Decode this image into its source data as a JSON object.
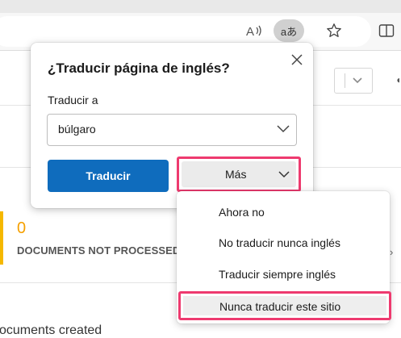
{
  "browser": {
    "read_aloud_icon": "read-aloud-icon",
    "translate_icon_text": "aあ",
    "favorite_icon": "star-icon",
    "split_icon": "split-screen-icon"
  },
  "page": {
    "count_value": "0",
    "count_label": "DOCUMENTS NOT PROCESSED",
    "section_heading": "ocuments created"
  },
  "translate_popup": {
    "title": "¿Traducir página de inglés?",
    "translate_to_label": "Traducir a",
    "selected_language": "búlgaro",
    "translate_button": "Traducir",
    "more_button": "Más"
  },
  "more_menu": {
    "items": [
      "Ahora no",
      "No traducir nunca inglés",
      "Traducir siempre inglés",
      "Nunca traducir este sitio"
    ]
  },
  "colors": {
    "primary_button": "#0f6cbd",
    "highlight_outline": "#ee3a6f",
    "accent_yellow": "#f5b800"
  }
}
